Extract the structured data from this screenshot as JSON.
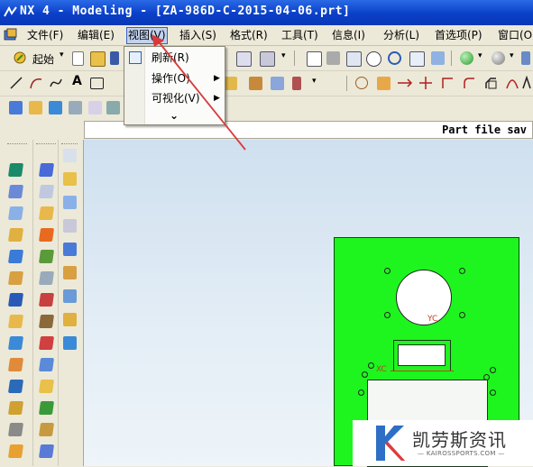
{
  "window": {
    "title": "NX 4 - Modeling - [ZA-986D-C-2015-04-06.prt]"
  },
  "menu": {
    "items": [
      {
        "label": "文件(F)"
      },
      {
        "label": "编辑(E)"
      },
      {
        "label": "视图(V)"
      },
      {
        "label": "插入(S)"
      },
      {
        "label": "格式(R)"
      },
      {
        "label": "工具(T)"
      },
      {
        "label": "信息(I)"
      },
      {
        "label": "分析(L)"
      },
      {
        "label": "首选项(P)"
      },
      {
        "label": "窗口(O)"
      }
    ]
  },
  "toolbar": {
    "start_label": "起始"
  },
  "view_menu": {
    "items": [
      {
        "label": "刷新(R)"
      },
      {
        "label": "操作(O)"
      },
      {
        "label": "可视化(V)"
      }
    ],
    "more_glyph": "⌄"
  },
  "status": {
    "text": "Part file sav"
  },
  "viewport": {
    "plate_color": "#1ef51e",
    "axis_label_yc": "YC",
    "axis_label_xc": "XC"
  },
  "watermark": {
    "brand": "凯劳斯资讯",
    "url": "— KAIROSSPORTS.COM —"
  },
  "colors": {
    "titlebar": "#0a3fc8",
    "menu_highlight": "#c1d2ee",
    "arrow": "#d83a3a"
  }
}
